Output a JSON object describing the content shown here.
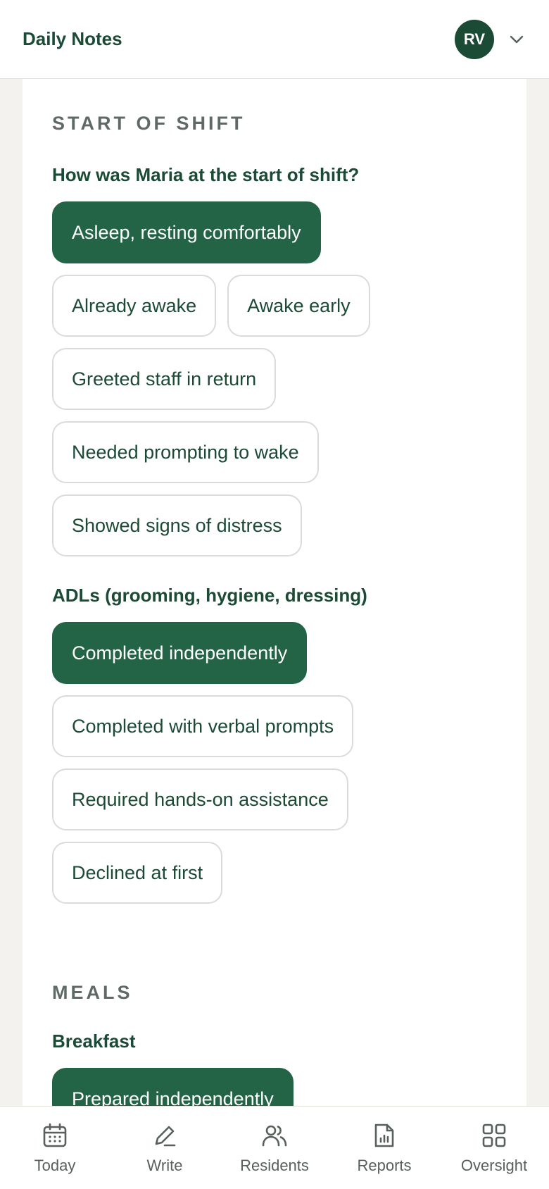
{
  "header": {
    "title": "Daily Notes",
    "avatar_initials": "RV"
  },
  "start_of_shift": {
    "section_title": "START OF SHIFT",
    "q1": {
      "label": "How was Maria at the start of shift?",
      "options": [
        {
          "label": "Asleep, resting comfortably",
          "selected": true
        },
        {
          "label": "Already awake",
          "selected": false
        },
        {
          "label": "Awake early",
          "selected": false
        },
        {
          "label": "Greeted staff in return",
          "selected": false
        },
        {
          "label": "Needed prompting to wake",
          "selected": false
        },
        {
          "label": "Showed signs of distress",
          "selected": false
        }
      ]
    },
    "q2": {
      "label": "ADLs (grooming, hygiene, dressing)",
      "options": [
        {
          "label": "Completed independently",
          "selected": true
        },
        {
          "label": "Completed with verbal prompts",
          "selected": false
        },
        {
          "label": "Required hands-on assistance",
          "selected": false
        },
        {
          "label": "Declined at first",
          "selected": false
        }
      ]
    }
  },
  "meals": {
    "section_title": "MEALS",
    "q1": {
      "label": "Breakfast",
      "options": [
        {
          "label": "Prepared independently",
          "selected": true
        }
      ]
    }
  },
  "nav": {
    "items": [
      {
        "label": "Today",
        "icon": "calendar-icon"
      },
      {
        "label": "Write",
        "icon": "pencil-icon"
      },
      {
        "label": "Residents",
        "icon": "users-icon"
      },
      {
        "label": "Reports",
        "icon": "report-icon"
      },
      {
        "label": "Oversight",
        "icon": "grid-icon"
      }
    ]
  },
  "colors": {
    "brand": "#1b4a35",
    "selected": "#246446",
    "background": "#f4f2ee"
  }
}
